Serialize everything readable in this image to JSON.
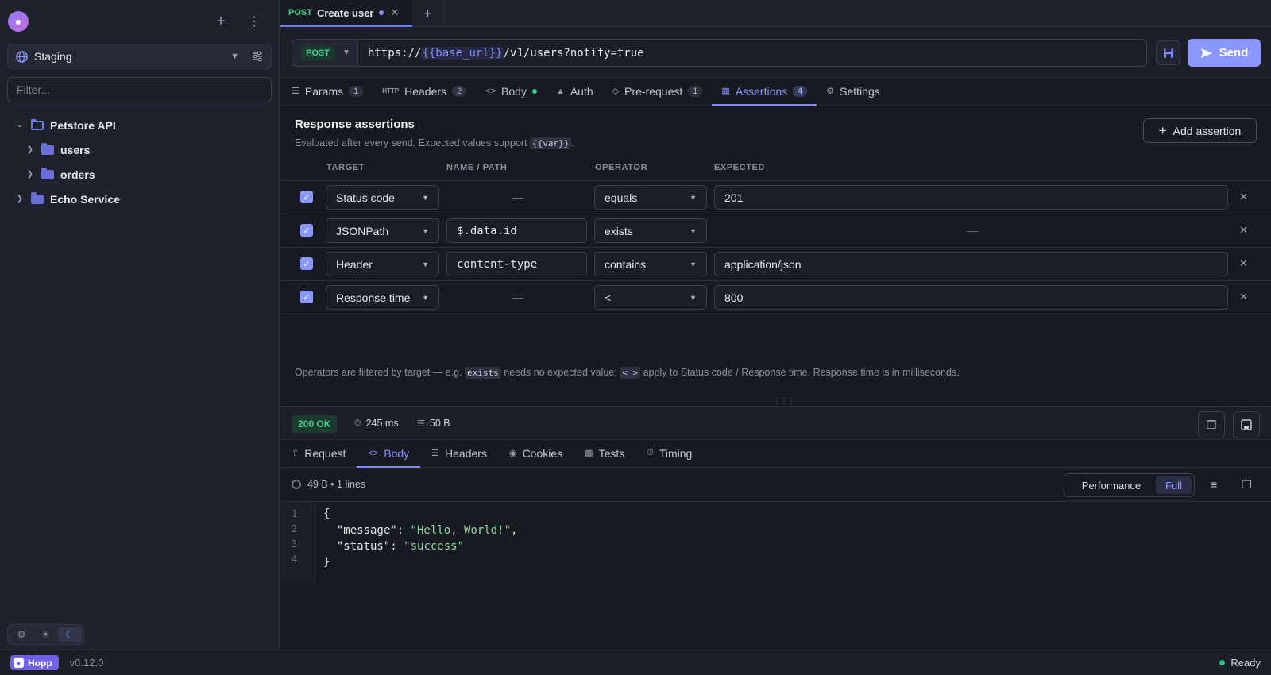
{
  "sidebar": {
    "environment": "Staging",
    "filter_placeholder": "Filter...",
    "tree": [
      {
        "label": "Petstore API"
      },
      {
        "label": "users"
      },
      {
        "label": "orders"
      },
      {
        "label": "Echo Service"
      }
    ]
  },
  "tabs": {
    "active": {
      "method": "POST",
      "title": "Create user"
    }
  },
  "request": {
    "method": "POST",
    "url_prefix": "https://",
    "url_var": "{{base_url}}",
    "url_suffix": "/v1/users?notify=true",
    "send_label": "Send"
  },
  "subtabs": [
    {
      "label": "Params",
      "count": "1"
    },
    {
      "label": "Headers",
      "count": "2"
    },
    {
      "label": "Body"
    },
    {
      "label": "Auth"
    },
    {
      "label": "Pre-request",
      "count": "1"
    },
    {
      "label": "Assertions",
      "count": "4"
    },
    {
      "label": "Settings"
    }
  ],
  "assertions": {
    "title": "Response assertions",
    "subtitle_pre": "Evaluated after every send. Expected values support",
    "subtitle_var": "{{var}}",
    "subtitle_post": ".",
    "add_label": "Add assertion",
    "columns": [
      "TARGET",
      "NAME / PATH",
      "OPERATOR",
      "EXPECTED"
    ],
    "rows": [
      {
        "target": "Status code",
        "path": "—",
        "operator": "equals",
        "expected": "201"
      },
      {
        "target": "JSONPath",
        "path": "$.data.id",
        "operator": "exists",
        "expected": "—"
      },
      {
        "target": "Header",
        "path": "content-type",
        "operator": "contains",
        "expected": "application/json"
      },
      {
        "target": "Response time",
        "path": "—",
        "operator": "<",
        "expected": "800"
      }
    ],
    "note_a": "Operators are filtered by target — e.g.",
    "note_code1": "exists",
    "note_b": "needs no expected value;",
    "note_code2": "< >",
    "note_c": "apply to Status code / Response time. Response time is in milliseconds."
  },
  "response": {
    "status": "200 OK",
    "time": "245 ms",
    "size": "50 B",
    "tabs": [
      "Request",
      "Body",
      "Headers",
      "Cookies",
      "Tests",
      "Timing"
    ],
    "body_meta": "49 B • 1 lines",
    "mode_performance": "Performance",
    "mode_full": "Full",
    "line_numbers": [
      "1",
      "2",
      "3",
      "4"
    ],
    "json": {
      "open": "{",
      "k1": "\"message\"",
      "v1": "\"Hello, World!\"",
      "k2": "\"status\"",
      "v2": "\"success\"",
      "close": "}"
    }
  },
  "footer": {
    "app": "Hopp",
    "version": "v0.12.0",
    "status": "Ready"
  },
  "colors": {
    "accent": "#8b96ff",
    "method_post": "#3fcf8e",
    "status_ok": "#3fcf8e",
    "background": "#181a22"
  }
}
